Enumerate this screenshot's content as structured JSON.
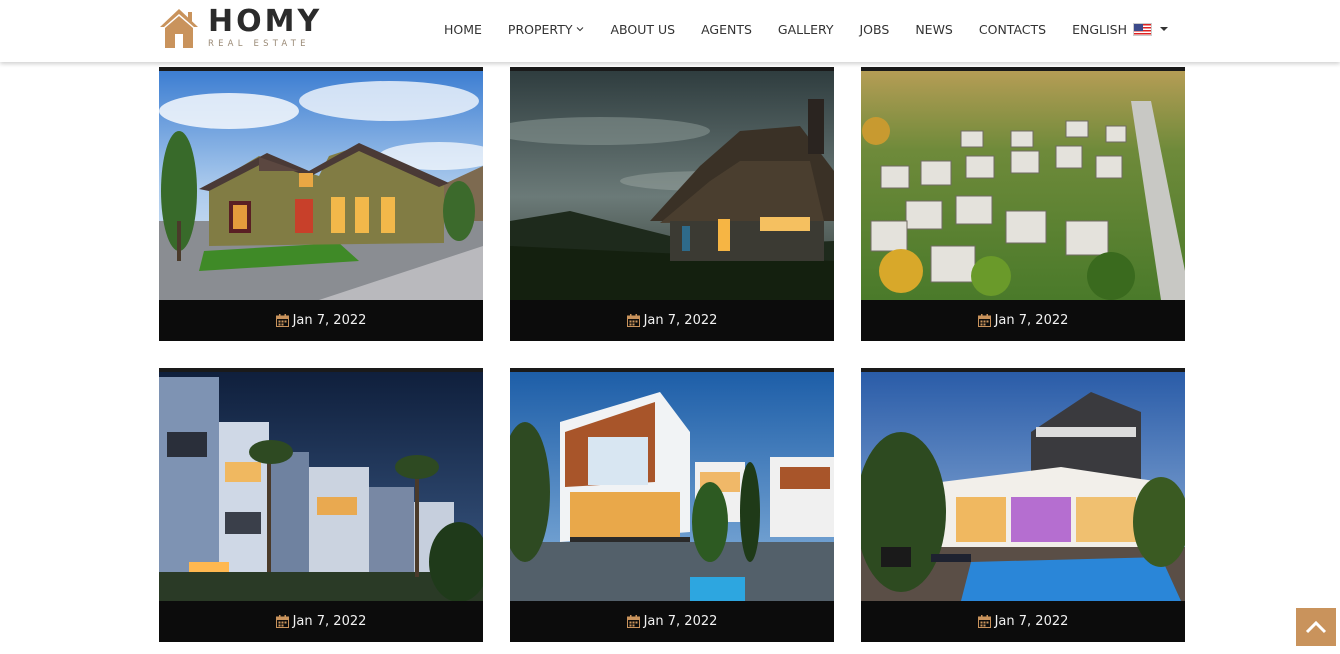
{
  "header": {
    "logo": {
      "name": "HOMY",
      "tagline": "REAL ESTATE",
      "icon": "house-logo-icon"
    },
    "nav": [
      {
        "label": "HOME"
      },
      {
        "label": "PROPERTY",
        "icon": "chevron-down-icon"
      },
      {
        "label": "ABOUT US"
      },
      {
        "label": "AGENTS"
      },
      {
        "label": "GALLERY"
      },
      {
        "label": "JOBS"
      },
      {
        "label": "NEWS"
      },
      {
        "label": "CONTACTS"
      }
    ],
    "language": {
      "label": "ENGLISH",
      "icon": "us-flag-icon"
    }
  },
  "gallery": {
    "items": [
      {
        "date": "Jan 7, 2022",
        "image": "suburban house at dusk"
      },
      {
        "date": "Jan 7, 2022",
        "image": "thatched cottage at twilight"
      },
      {
        "date": "Jan 7, 2022",
        "image": "aerial view of neighborhood"
      },
      {
        "date": "Jan 7, 2022",
        "image": "modern apartment townhouses at night"
      },
      {
        "date": "Jan 7, 2022",
        "image": "modern villa with pool"
      },
      {
        "date": "Jan 7, 2022",
        "image": "luxury house with pool at night"
      }
    ]
  },
  "colors": {
    "accent": "#c9935c",
    "caption_bg": "#0c0c0c",
    "nav_text": "#333333"
  },
  "back_to_top": {
    "icon": "chevron-up-icon"
  }
}
